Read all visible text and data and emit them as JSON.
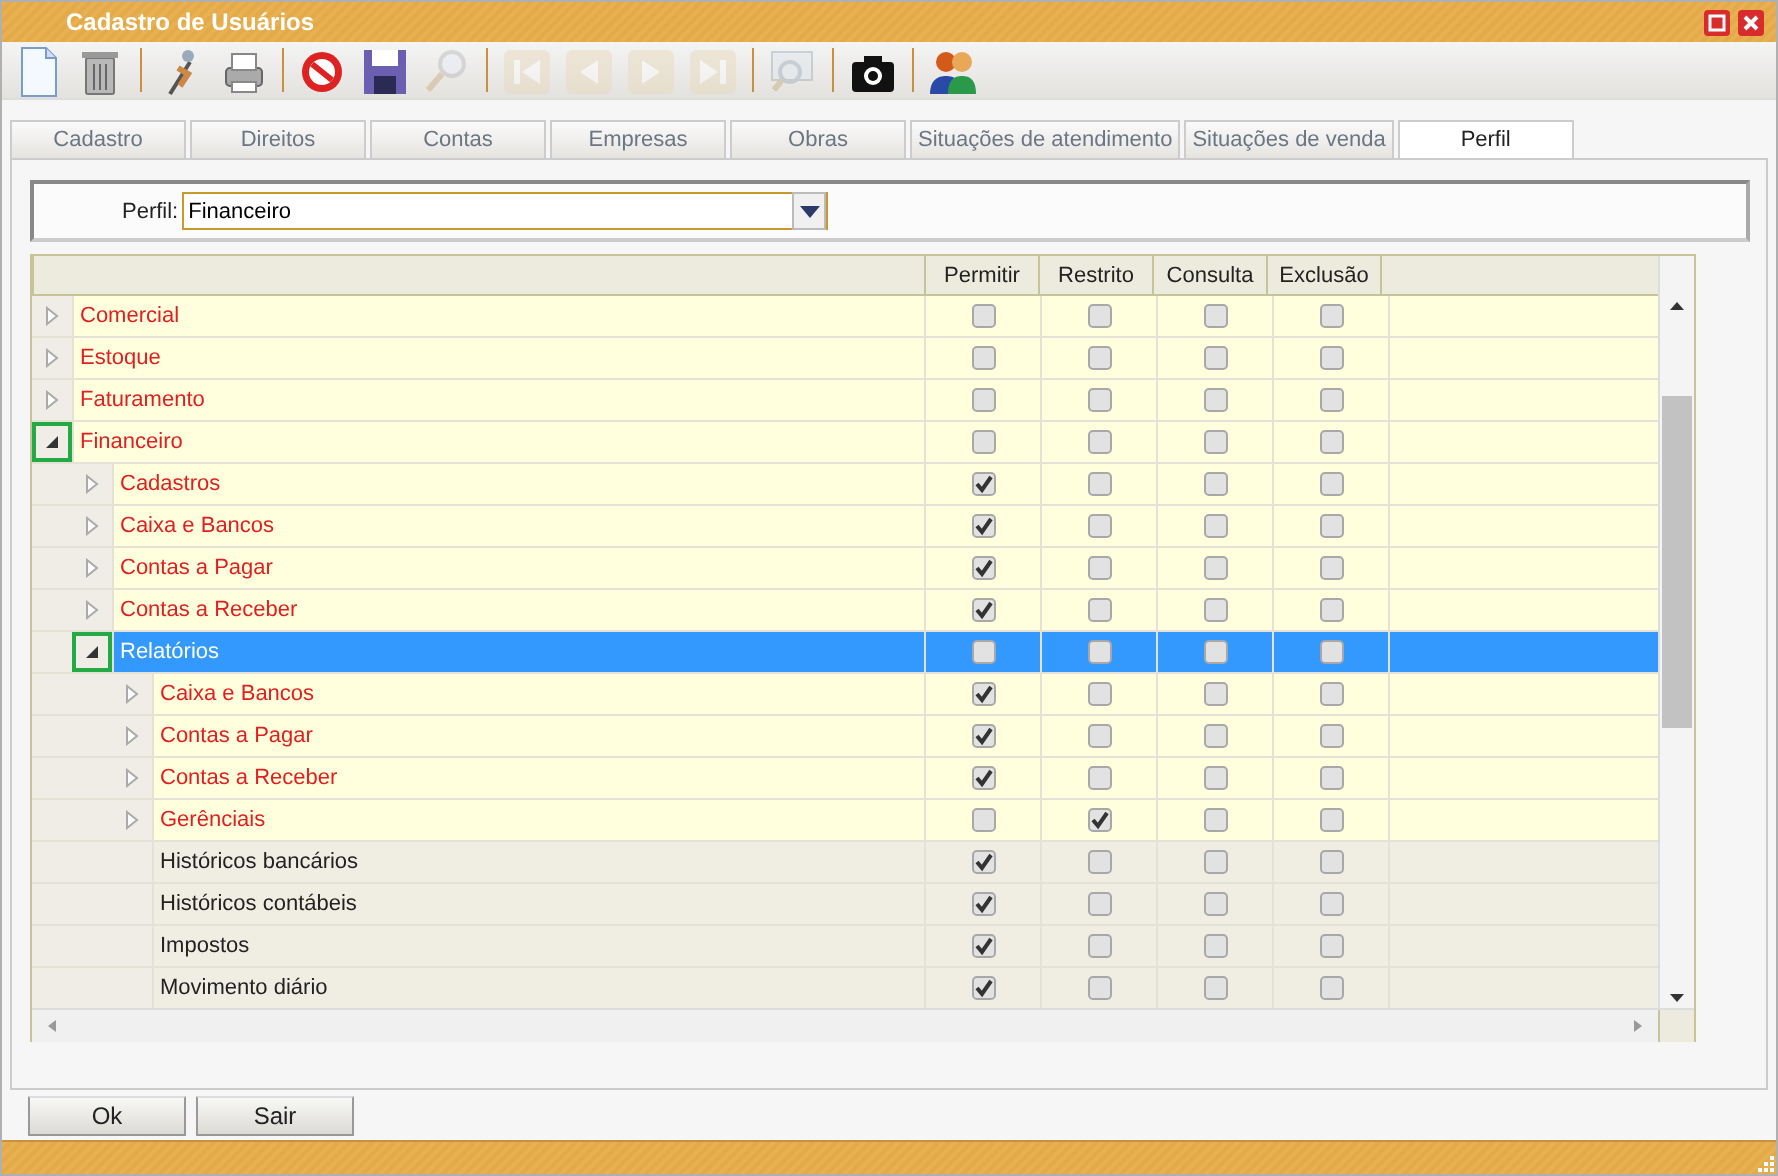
{
  "window": {
    "title": "Cadastro de Usuários"
  },
  "toolbar": [
    {
      "kind": "new",
      "disabled": false
    },
    {
      "kind": "delete",
      "disabled": false
    },
    {
      "kind": "separator"
    },
    {
      "kind": "clean",
      "disabled": false
    },
    {
      "kind": "print",
      "disabled": false
    },
    {
      "kind": "separator"
    },
    {
      "kind": "cancel",
      "disabled": false
    },
    {
      "kind": "save",
      "disabled": false
    },
    {
      "kind": "search",
      "disabled": true
    },
    {
      "kind": "separator"
    },
    {
      "kind": "first",
      "disabled": true
    },
    {
      "kind": "previous",
      "disabled": true
    },
    {
      "kind": "next",
      "disabled": true
    },
    {
      "kind": "last",
      "disabled": true
    },
    {
      "kind": "separator"
    },
    {
      "kind": "preview",
      "disabled": true
    },
    {
      "kind": "separator"
    },
    {
      "kind": "camera",
      "disabled": false
    },
    {
      "kind": "separator"
    },
    {
      "kind": "users",
      "disabled": false
    }
  ],
  "tabs": [
    {
      "label": "Cadastro",
      "selected": false
    },
    {
      "label": "Direitos",
      "selected": false
    },
    {
      "label": "Contas",
      "selected": false
    },
    {
      "label": "Empresas",
      "selected": false
    },
    {
      "label": "Obras",
      "selected": false
    },
    {
      "label": "Situações de atendimento",
      "selected": false
    },
    {
      "label": "Situações de venda",
      "selected": false
    },
    {
      "label": "Perfil",
      "selected": true
    }
  ],
  "perfil": {
    "label": "Perfil:",
    "value": "Financeiro"
  },
  "tree": {
    "columns": [
      "Permitir",
      "Restrito",
      "Consulta",
      "Exclusão"
    ],
    "rows": [
      {
        "label": "Comercial",
        "kind": "group",
        "expanded": false,
        "selected": false,
        "highlighted": false,
        "checks": [
          false,
          false,
          false,
          false
        ]
      },
      {
        "label": "Estoque",
        "kind": "group",
        "expanded": false,
        "selected": false,
        "highlighted": false,
        "checks": [
          false,
          false,
          false,
          false
        ]
      },
      {
        "label": "Faturamento",
        "kind": "group",
        "expanded": false,
        "selected": false,
        "highlighted": false,
        "checks": [
          false,
          false,
          false,
          false
        ]
      },
      {
        "label": "Financeiro",
        "kind": "group",
        "expanded": true,
        "selected": false,
        "highlighted": true,
        "checks": [
          false,
          false,
          false,
          false
        ],
        "children": [
          {
            "label": "Cadastros",
            "kind": "group",
            "expanded": false,
            "selected": false,
            "highlighted": false,
            "checks": [
              true,
              false,
              false,
              false
            ]
          },
          {
            "label": "Caixa e Bancos",
            "kind": "group",
            "expanded": false,
            "selected": false,
            "highlighted": false,
            "checks": [
              true,
              false,
              false,
              false
            ]
          },
          {
            "label": "Contas a Pagar",
            "kind": "group",
            "expanded": false,
            "selected": false,
            "highlighted": false,
            "checks": [
              true,
              false,
              false,
              false
            ]
          },
          {
            "label": "Contas a Receber",
            "kind": "group",
            "expanded": false,
            "selected": false,
            "highlighted": false,
            "checks": [
              true,
              false,
              false,
              false
            ]
          },
          {
            "label": "Relatórios",
            "kind": "group",
            "expanded": true,
            "selected": true,
            "highlighted": true,
            "checks": [
              false,
              false,
              false,
              false
            ],
            "children": [
              {
                "label": "Caixa e Bancos",
                "kind": "group",
                "expanded": false,
                "selected": false,
                "highlighted": false,
                "checks": [
                  true,
                  false,
                  false,
                  false
                ]
              },
              {
                "label": "Contas a Pagar",
                "kind": "group",
                "expanded": false,
                "selected": false,
                "highlighted": false,
                "checks": [
                  true,
                  false,
                  false,
                  false
                ]
              },
              {
                "label": "Contas a Receber",
                "kind": "group",
                "expanded": false,
                "selected": false,
                "highlighted": false,
                "checks": [
                  true,
                  false,
                  false,
                  false
                ]
              },
              {
                "label": "Gerênciais",
                "kind": "group",
                "expanded": false,
                "selected": false,
                "highlighted": false,
                "checks": [
                  false,
                  true,
                  false,
                  false
                ]
              },
              {
                "label": "Históricos bancários",
                "kind": "item",
                "selected": false,
                "highlighted": false,
                "checks": [
                  true,
                  false,
                  false,
                  false
                ]
              },
              {
                "label": "Históricos contábeis",
                "kind": "item",
                "selected": false,
                "highlighted": false,
                "checks": [
                  true,
                  false,
                  false,
                  false
                ]
              },
              {
                "label": "Impostos",
                "kind": "item",
                "selected": false,
                "highlighted": false,
                "checks": [
                  true,
                  false,
                  false,
                  false
                ]
              },
              {
                "label": "Movimento diário",
                "kind": "item",
                "selected": false,
                "highlighted": false,
                "checks": [
                  true,
                  false,
                  false,
                  false
                ]
              }
            ]
          }
        ]
      }
    ]
  },
  "buttons": [
    "Ok",
    "Sair"
  ]
}
